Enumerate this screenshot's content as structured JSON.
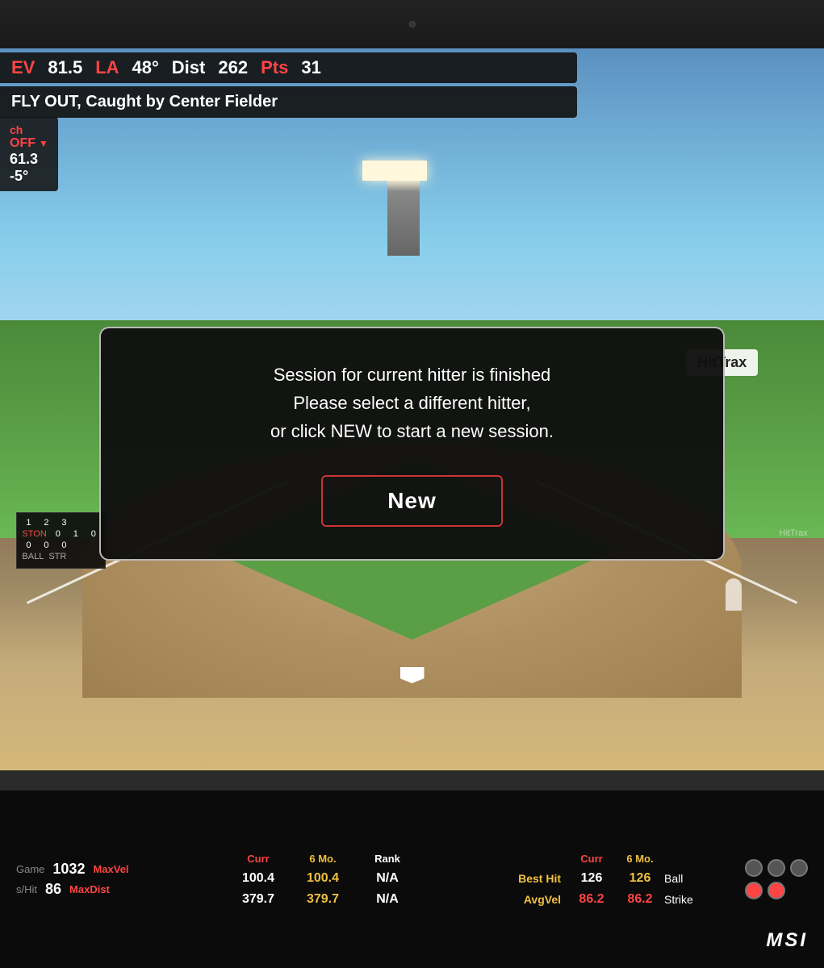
{
  "monitor": {
    "brand": "MSI"
  },
  "hud": {
    "ev_label": "EV",
    "ev_value": "81.5",
    "la_label": "LA",
    "la_value": "48°",
    "dist_label": "Dist",
    "dist_value": "262",
    "pts_label": "Pts",
    "pts_value": "31",
    "flyout_text": "FLY OUT, Caught by Center Fielder"
  },
  "left_panel": {
    "mode_label": "ch",
    "toggle_label": "OFF",
    "value1": "61.3",
    "value2": "-5°"
  },
  "hittrax_logo": "HitTrax",
  "hittrax_small": "HitTrax",
  "dialog": {
    "message_line1": "Session for current hitter is finished",
    "message_line2": "Please select a different hitter,",
    "message_line3": "or click NEW to start a new session.",
    "new_button_label": "New"
  },
  "scoreboard": {
    "row1_label": "",
    "innings": [
      "1",
      "2",
      "3"
    ],
    "team1": "STON",
    "team1_scores": [
      "0",
      "1",
      "0"
    ],
    "team2_scores": [
      "0",
      "0",
      "0"
    ],
    "ball_label": "BALL",
    "strike_label": "STR"
  },
  "bottom_stats": {
    "left": {
      "game_label": "Game",
      "game_value": "1032",
      "maxvel_label": "MaxVel",
      "hit_label": "s/Hit",
      "hit_value": "86",
      "maxdist_label": "MaxDist"
    },
    "table": {
      "col_curr": "Curr",
      "col_6mo": "6 Mo.",
      "col_rank": "Rank",
      "row1_label": "",
      "row1_curr": "100.4",
      "row1_6mo": "100.4",
      "row1_rank": "N/A",
      "row2_label": "",
      "row2_curr": "379.7",
      "row2_6mo": "379.7",
      "row2_rank": "N/A"
    },
    "right": {
      "best_hit_label": "Best Hit",
      "avg_vel_label": "AvgVel",
      "col_curr": "Curr",
      "col_6mo": "6 Mo.",
      "besthit_curr": "126",
      "besthit_6mo": "126",
      "besthit_label": "Ball",
      "avgvel_curr": "86.2",
      "avgvel_6mo": "86.2",
      "avgvel_label": "Strike"
    },
    "circles": {
      "ball_label": "Ball",
      "strike_label": "Strike",
      "ball_count": 0,
      "strike_count": 2
    }
  }
}
